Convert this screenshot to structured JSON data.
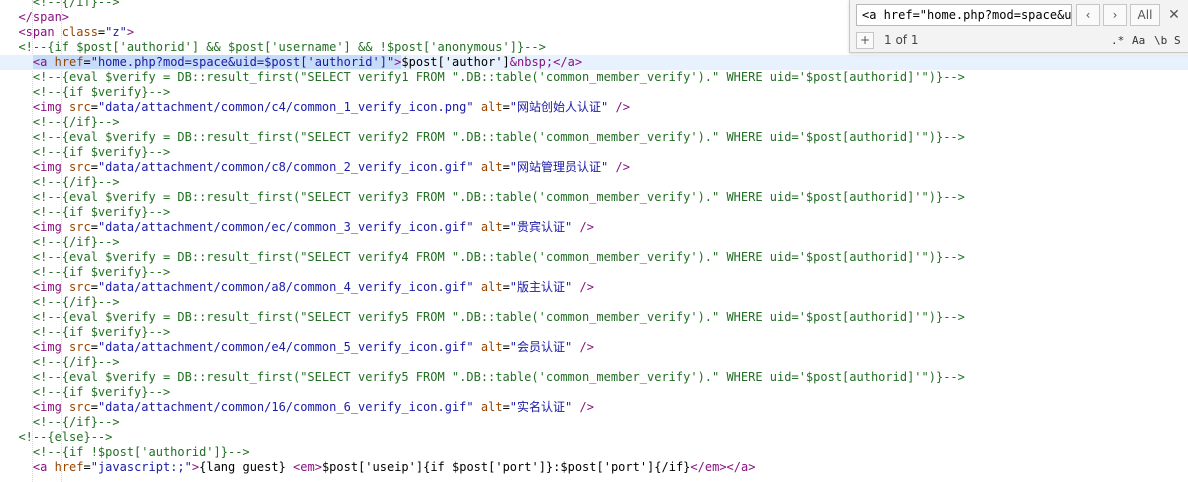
{
  "editor": {
    "lines": [
      [
        [
          "c",
          "    <!--{/if}-->"
        ]
      ],
      [
        [
          "t",
          "  </span>"
        ]
      ],
      [
        [
          "t",
          "  <span "
        ],
        [
          "a",
          "class"
        ],
        [
          "x",
          "="
        ],
        [
          "s",
          "\"z\""
        ],
        [
          "t",
          ">"
        ]
      ],
      [
        [
          "c",
          "  <!--{if $post['authorid'] && $post['username'] && !$post['anonymous']}-->"
        ]
      ],
      [
        [
          "x",
          "    "
        ],
        [
          "t",
          "<a "
        ],
        [
          "a",
          "href"
        ],
        [
          "x",
          "="
        ],
        [
          "s",
          "\"home.php?mod=space&uid=$post['authorid']\""
        ],
        [
          "t",
          ">"
        ],
        [
          "x",
          "$post['author']"
        ],
        [
          "e",
          "&nbsp;"
        ],
        [
          "t",
          "</a>"
        ]
      ],
      [
        [
          "c",
          "    <!--{eval $verify = DB::result_first(\"SELECT verify1 FROM \".DB::table('common_member_verify').\" WHERE uid='$post[authorid]'\")}-->"
        ]
      ],
      [
        [
          "c",
          "    <!--{if $verify}-->"
        ]
      ],
      [
        [
          "x",
          "    "
        ],
        [
          "t",
          "<img "
        ],
        [
          "a",
          "src"
        ],
        [
          "x",
          "="
        ],
        [
          "s",
          "\"data/attachment/common/c4/common_1_verify_icon.png\""
        ],
        [
          "x",
          " "
        ],
        [
          "a",
          "alt"
        ],
        [
          "x",
          "="
        ],
        [
          "s",
          "\"网站创始人认证\""
        ],
        [
          "t",
          " />"
        ]
      ],
      [
        [
          "c",
          "    <!--{/if}-->"
        ]
      ],
      [
        [
          "c",
          "    <!--{eval $verify = DB::result_first(\"SELECT verify2 FROM \".DB::table('common_member_verify').\" WHERE uid='$post[authorid]'\")}-->"
        ]
      ],
      [
        [
          "c",
          "    <!--{if $verify}-->"
        ]
      ],
      [
        [
          "x",
          "    "
        ],
        [
          "t",
          "<img "
        ],
        [
          "a",
          "src"
        ],
        [
          "x",
          "="
        ],
        [
          "s",
          "\"data/attachment/common/c8/common_2_verify_icon.gif\""
        ],
        [
          "x",
          " "
        ],
        [
          "a",
          "alt"
        ],
        [
          "x",
          "="
        ],
        [
          "s",
          "\"网站管理员认证\""
        ],
        [
          "t",
          " />"
        ]
      ],
      [
        [
          "c",
          "    <!--{/if}-->"
        ]
      ],
      [
        [
          "c",
          "    <!--{eval $verify = DB::result_first(\"SELECT verify3 FROM \".DB::table('common_member_verify').\" WHERE uid='$post[authorid]'\")}-->"
        ]
      ],
      [
        [
          "c",
          "    <!--{if $verify}-->"
        ]
      ],
      [
        [
          "x",
          "    "
        ],
        [
          "t",
          "<img "
        ],
        [
          "a",
          "src"
        ],
        [
          "x",
          "="
        ],
        [
          "s",
          "\"data/attachment/common/ec/common_3_verify_icon.gif\""
        ],
        [
          "x",
          " "
        ],
        [
          "a",
          "alt"
        ],
        [
          "x",
          "="
        ],
        [
          "s",
          "\"贵宾认证\""
        ],
        [
          "t",
          " />"
        ]
      ],
      [
        [
          "c",
          "    <!--{/if}-->"
        ]
      ],
      [
        [
          "c",
          "    <!--{eval $verify = DB::result_first(\"SELECT verify4 FROM \".DB::table('common_member_verify').\" WHERE uid='$post[authorid]'\")}-->"
        ]
      ],
      [
        [
          "c",
          "    <!--{if $verify}-->"
        ]
      ],
      [
        [
          "x",
          "    "
        ],
        [
          "t",
          "<img "
        ],
        [
          "a",
          "src"
        ],
        [
          "x",
          "="
        ],
        [
          "s",
          "\"data/attachment/common/a8/common_4_verify_icon.gif\""
        ],
        [
          "x",
          " "
        ],
        [
          "a",
          "alt"
        ],
        [
          "x",
          "="
        ],
        [
          "s",
          "\"版主认证\""
        ],
        [
          "t",
          " />"
        ]
      ],
      [
        [
          "c",
          "    <!--{/if}-->"
        ]
      ],
      [
        [
          "c",
          "    <!--{eval $verify = DB::result_first(\"SELECT verify5 FROM \".DB::table('common_member_verify').\" WHERE uid='$post[authorid]'\")}-->"
        ]
      ],
      [
        [
          "c",
          "    <!--{if $verify}-->"
        ]
      ],
      [
        [
          "x",
          "    "
        ],
        [
          "t",
          "<img "
        ],
        [
          "a",
          "src"
        ],
        [
          "x",
          "="
        ],
        [
          "s",
          "\"data/attachment/common/e4/common_5_verify_icon.gif\""
        ],
        [
          "x",
          " "
        ],
        [
          "a",
          "alt"
        ],
        [
          "x",
          "="
        ],
        [
          "s",
          "\"会员认证\""
        ],
        [
          "t",
          " />"
        ]
      ],
      [
        [
          "c",
          "    <!--{/if}-->"
        ]
      ],
      [
        [
          "c",
          "    <!--{eval $verify = DB::result_first(\"SELECT verify5 FROM \".DB::table('common_member_verify').\" WHERE uid='$post[authorid]'\")}-->"
        ]
      ],
      [
        [
          "c",
          "    <!--{if $verify}-->"
        ]
      ],
      [
        [
          "x",
          "    "
        ],
        [
          "t",
          "<img "
        ],
        [
          "a",
          "src"
        ],
        [
          "x",
          "="
        ],
        [
          "s",
          "\"data/attachment/common/16/common_6_verify_icon.gif\""
        ],
        [
          "x",
          " "
        ],
        [
          "a",
          "alt"
        ],
        [
          "x",
          "="
        ],
        [
          "s",
          "\"实名认证\""
        ],
        [
          "t",
          " />"
        ]
      ],
      [
        [
          "c",
          "    <!--{/if}-->"
        ]
      ],
      [
        [
          "c",
          "  <!--{else}-->"
        ]
      ],
      [
        [
          "c",
          "    <!--{if !$post['authorid']}-->"
        ]
      ],
      [
        [
          "x",
          "    "
        ],
        [
          "t",
          "<a "
        ],
        [
          "a",
          "href"
        ],
        [
          "x",
          "="
        ],
        [
          "s",
          "\"javascript:;\""
        ],
        [
          "t",
          ">"
        ],
        [
          "x",
          "{lang guest} "
        ],
        [
          "t",
          "<em>"
        ],
        [
          "x",
          "$post['useip']{if $post['port']}:$post['port']{/if}"
        ],
        [
          "t",
          "</em></a>"
        ]
      ]
    ],
    "current_line": 4,
    "colors": {
      "comment": "#236e24",
      "tag": "#881280",
      "attr": "#994500",
      "string": "#1a1aa6",
      "selection": "#c6dcf8",
      "current_line": "#e8f2fe"
    }
  },
  "findbar": {
    "query": "<a href=\"home.php?mod=space&u",
    "prev_label": "‹",
    "next_label": "›",
    "all_label": "All",
    "close_label": "✕",
    "add_label": "+",
    "match_count": "1 of 1",
    "options": [
      ".*",
      "Aa",
      "\\b",
      "S"
    ]
  }
}
